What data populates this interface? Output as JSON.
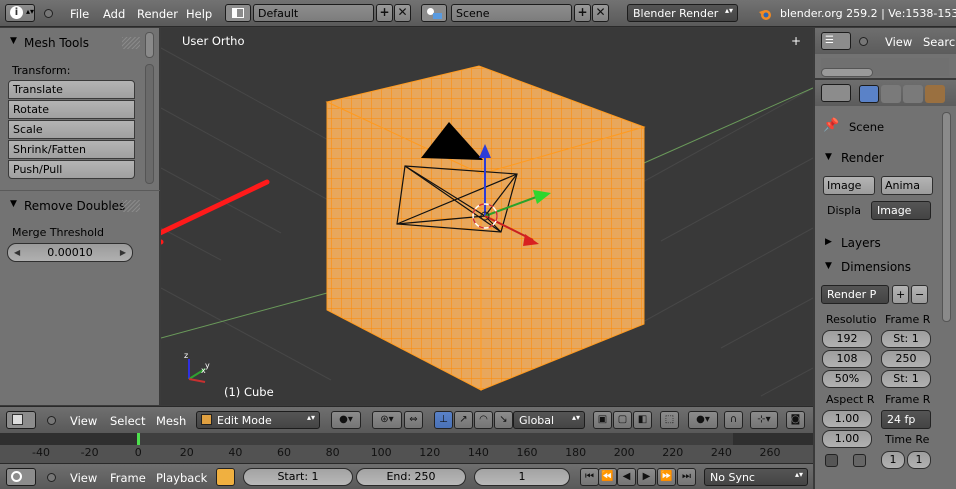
{
  "top_bar": {
    "menus": [
      "File",
      "Add",
      "Render",
      "Help"
    ],
    "screen_layout": "Default",
    "scene": "Scene",
    "render_engine": "Blender Render",
    "info": "blender.org 259.2 | Ve:1538-1538"
  },
  "tool_shelf": {
    "mesh_tools_title": "Mesh Tools",
    "transform_label": "Transform:",
    "tools": [
      "Translate",
      "Rotate",
      "Scale",
      "Shrink/Fatten",
      "Push/Pull"
    ],
    "operator_title": "Remove Doubles",
    "merge_threshold_label": "Merge Threshold",
    "merge_threshold_value": "0.00010"
  },
  "viewport": {
    "view_label": "User Ortho",
    "object_label": "(1) Cube",
    "colors": {
      "background": "#393939",
      "cube_face": "#e6a45c",
      "grid_wire": "#ff8a00",
      "arrow": "#ff1a1a",
      "axis_x": "#c83030",
      "axis_y": "#30a030",
      "axis_z": "#3030e0"
    }
  },
  "right_panel": {
    "outliner_view": "View",
    "outliner_search": "Search",
    "scene_label": "Scene",
    "render_title": "Render",
    "image_button": "Image",
    "animation_button": "Anima",
    "display_label": "Displa",
    "display_value": "Image",
    "layers_title": "Layers",
    "dimensions_title": "Dimensions",
    "render_preset": "Render P",
    "resolution_label": "Resolutio",
    "res_x": "192",
    "res_y": "108",
    "res_pct": "50%",
    "frame_range_label": "Frame R",
    "frame_start": "St: 1",
    "frame_end": "250",
    "frame_step": "St: 1",
    "aspect_label": "Aspect R",
    "aspect_x": "1.00",
    "aspect_y": "1.00",
    "frame_rate_label": "Frame R",
    "frame_rate_value": "24 fp",
    "time_remap_label": "Time Re",
    "time_old": "1",
    "time_new": "1"
  },
  "viewport_header": {
    "menus": [
      "View",
      "Select",
      "Mesh"
    ],
    "mode": "Edit Mode",
    "orientation": "Global"
  },
  "timeline": {
    "ticks": [
      "-40",
      "-20",
      "0",
      "20",
      "40",
      "60",
      "80",
      "100",
      "120",
      "140",
      "160",
      "180",
      "200",
      "220",
      "240",
      "260"
    ],
    "current_frame": 0
  },
  "timeline_header": {
    "menus": [
      "View",
      "Frame",
      "Playback"
    ],
    "start": "Start: 1",
    "end": "End: 250",
    "current": "1",
    "sync": "No Sync"
  }
}
